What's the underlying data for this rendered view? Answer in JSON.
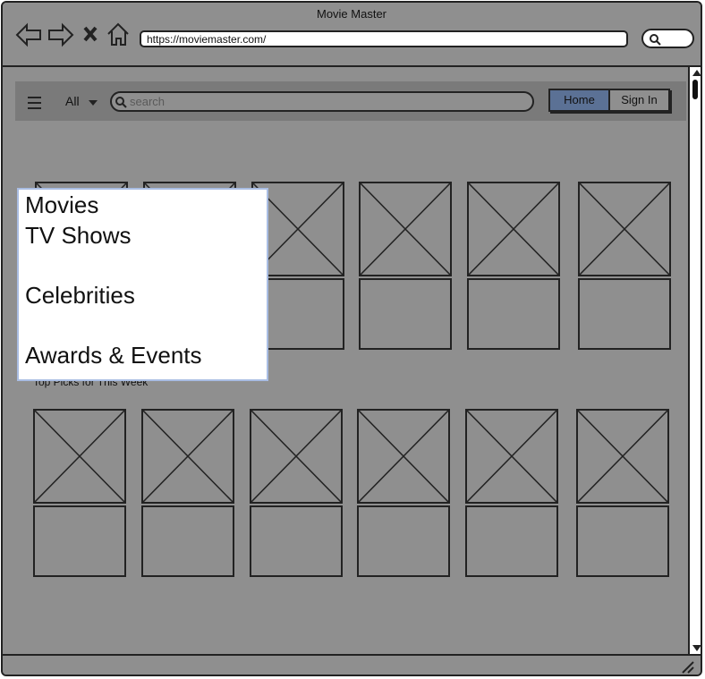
{
  "window": {
    "title": "Movie Master",
    "url": "https://moviemaster.com/"
  },
  "toolbar": {
    "category": "All",
    "search_placeholder": "search",
    "home_label": "Home",
    "signin_label": "Sign In"
  },
  "dropdown": {
    "items": [
      "Movies",
      "TV Shows",
      "Celebrities",
      "Awards & Events"
    ]
  },
  "sections": [
    {
      "label": ""
    },
    {
      "label": "Top Picks for This Week"
    }
  ],
  "icons": [
    "back-icon",
    "forward-icon",
    "close-icon",
    "home-icon",
    "search-icon",
    "hamburger-icon",
    "chevron-down-icon",
    "resize-grip-icon"
  ],
  "colors": {
    "background": "#8f8f8f",
    "accent": "#5b7195",
    "dropdown_border": "#a9bde3"
  }
}
